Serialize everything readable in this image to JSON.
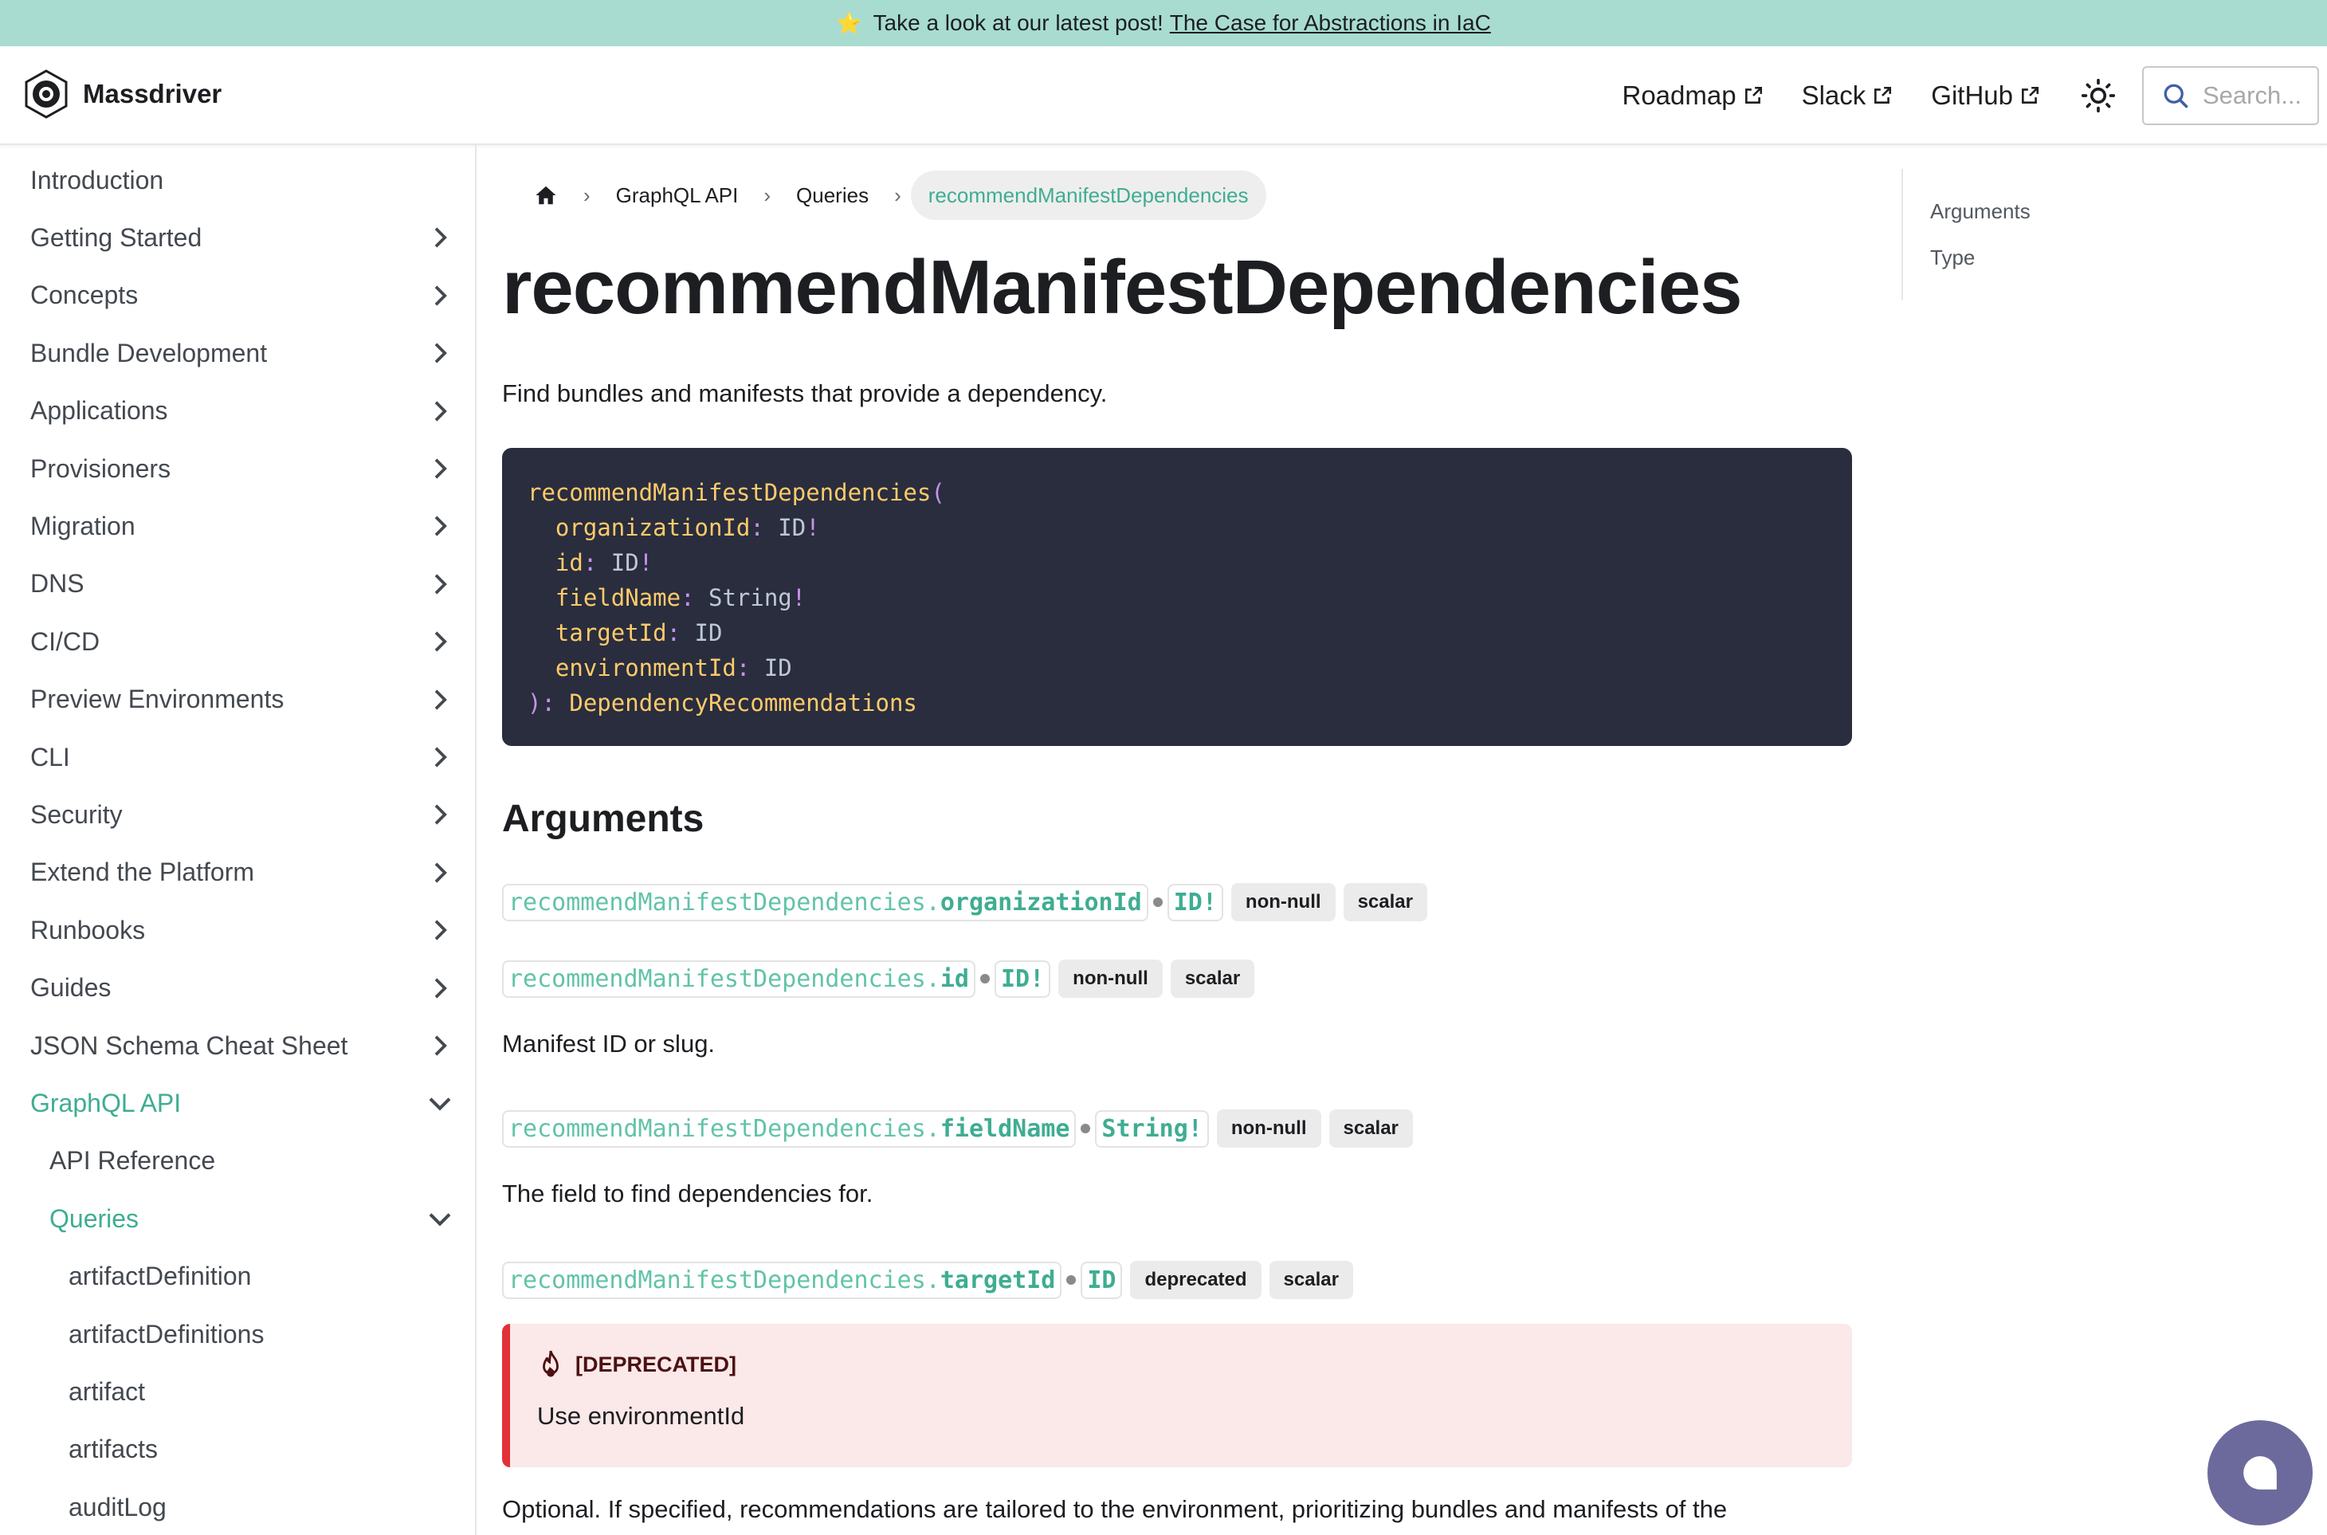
{
  "announcement": {
    "star": "⭐",
    "text": "Take a look at our latest post!",
    "link": "The Case for Abstractions in IaC"
  },
  "navbar": {
    "brand": "Massdriver",
    "links": [
      "Roadmap",
      "Slack",
      "GitHub"
    ],
    "search_placeholder": "Search..."
  },
  "sidebar": {
    "items": [
      {
        "label": "Introduction",
        "level": 1,
        "chevron": "none",
        "active": false
      },
      {
        "label": "Getting Started",
        "level": 1,
        "chevron": "right",
        "active": false
      },
      {
        "label": "Concepts",
        "level": 1,
        "chevron": "right",
        "active": false
      },
      {
        "label": "Bundle Development",
        "level": 1,
        "chevron": "right",
        "active": false
      },
      {
        "label": "Applications",
        "level": 1,
        "chevron": "right",
        "active": false
      },
      {
        "label": "Provisioners",
        "level": 1,
        "chevron": "right",
        "active": false
      },
      {
        "label": "Migration",
        "level": 1,
        "chevron": "right",
        "active": false
      },
      {
        "label": "DNS",
        "level": 1,
        "chevron": "right",
        "active": false
      },
      {
        "label": "CI/CD",
        "level": 1,
        "chevron": "right",
        "active": false
      },
      {
        "label": "Preview Environments",
        "level": 1,
        "chevron": "right",
        "active": false
      },
      {
        "label": "CLI",
        "level": 1,
        "chevron": "right",
        "active": false
      },
      {
        "label": "Security",
        "level": 1,
        "chevron": "right",
        "active": false
      },
      {
        "label": "Extend the Platform",
        "level": 1,
        "chevron": "right",
        "active": false
      },
      {
        "label": "Runbooks",
        "level": 1,
        "chevron": "right",
        "active": false
      },
      {
        "label": "Guides",
        "level": 1,
        "chevron": "right",
        "active": false
      },
      {
        "label": "JSON Schema Cheat Sheet",
        "level": 1,
        "chevron": "right",
        "active": false
      },
      {
        "label": "GraphQL API",
        "level": 1,
        "chevron": "down",
        "active": true
      },
      {
        "label": "API Reference",
        "level": 2,
        "chevron": "none",
        "active": false
      },
      {
        "label": "Queries",
        "level": 2,
        "chevron": "down",
        "active": true
      },
      {
        "label": "artifactDefinition",
        "level": 3,
        "chevron": "none",
        "active": false
      },
      {
        "label": "artifactDefinitions",
        "level": 3,
        "chevron": "none",
        "active": false
      },
      {
        "label": "artifact",
        "level": 3,
        "chevron": "none",
        "active": false
      },
      {
        "label": "artifacts",
        "level": 3,
        "chevron": "none",
        "active": false
      },
      {
        "label": "auditLog",
        "level": 3,
        "chevron": "none",
        "active": false
      }
    ]
  },
  "breadcrumbs": [
    "GraphQL API",
    "Queries",
    "recommendManifestDependencies"
  ],
  "page": {
    "title": "recommendManifestDependencies",
    "description": "Find bundles and manifests that provide a dependency."
  },
  "code": {
    "fn": "recommendManifestDependencies",
    "open": "(",
    "args": [
      {
        "name": "organizationId",
        "type": "ID",
        "bang": "!"
      },
      {
        "name": "id",
        "type": "ID",
        "bang": "!"
      },
      {
        "name": "fieldName",
        "type": "String",
        "bang": "!"
      },
      {
        "name": "targetId",
        "type": "ID",
        "bang": ""
      },
      {
        "name": "environmentId",
        "type": "ID",
        "bang": ""
      }
    ],
    "close": "):",
    "return_type": "DependencyRecommendations"
  },
  "arguments": {
    "heading": "Arguments",
    "fields": [
      {
        "prefix": "recommendManifestDependencies.",
        "name": "organizationId",
        "type": "ID!",
        "badges": [
          "non-null",
          "scalar"
        ],
        "description": ""
      },
      {
        "prefix": "recommendManifestDependencies.",
        "name": "id",
        "type": "ID!",
        "badges": [
          "non-null",
          "scalar"
        ],
        "description": "Manifest ID or slug."
      },
      {
        "prefix": "recommendManifestDependencies.",
        "name": "fieldName",
        "type": "String!",
        "badges": [
          "non-null",
          "scalar"
        ],
        "description": "The field to find dependencies for."
      },
      {
        "prefix": "recommendManifestDependencies.",
        "name": "targetId",
        "type": "ID",
        "badges": [
          "deprecated",
          "scalar"
        ],
        "description": ""
      }
    ]
  },
  "deprecation": {
    "title": "[DEPRECATED]",
    "body": "Use environmentId"
  },
  "footer_text": "Optional. If specified, recommendations are tailored to the environment, prioritizing bundles and manifests of the",
  "toc": [
    "Arguments",
    "Type"
  ],
  "colors": {
    "accent": "#3fad92",
    "announcement_bg": "#a8dcd1",
    "code_bg": "#292d3e",
    "danger": "#e13238",
    "chat_button": "#6c6a9c"
  }
}
